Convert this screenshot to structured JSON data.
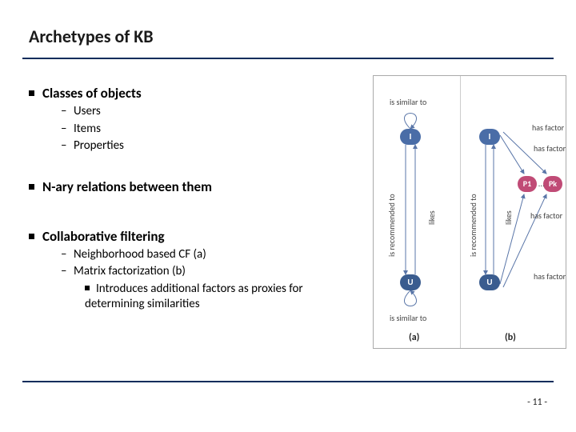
{
  "title": "Archetypes of KB",
  "bullets": {
    "classes": {
      "label": "Classes of objects",
      "items": [
        "Users",
        "Items",
        "Properties"
      ]
    },
    "nary": {
      "label": "N-ary relations between them"
    },
    "cf": {
      "label": "Collaborative filtering",
      "items": [
        "Neighborhood based CF (a)",
        "Matrix factorization (b)"
      ],
      "sub": "Introduces additional factors as proxies for determining similarities"
    }
  },
  "figure": {
    "nodes": {
      "I": "I",
      "U": "U",
      "P1": "P1",
      "Pk": "Pk"
    },
    "edges": {
      "similar": "is similar to",
      "recommended": "is recommended to",
      "likes": "likes",
      "has_factor": "has factor"
    },
    "ellipsis": "…",
    "caption_a": "(a)",
    "caption_b": "(b)"
  },
  "page": "- 11 -"
}
